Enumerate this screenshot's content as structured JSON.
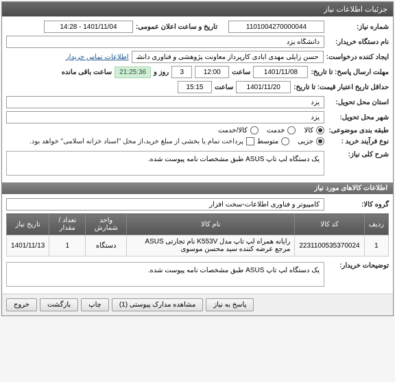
{
  "header": {
    "title": "جزئیات اطلاعات نیاز"
  },
  "fields": {
    "need_number_label": "شماره نیاز:",
    "need_number": "1101004270000044",
    "announce_label": "تاریخ و ساعت اعلان عمومی:",
    "announce_value": "1401/11/04 - 14:28",
    "org_label": "نام دستگاه خریدار:",
    "org_value": "دانشگاه یزد",
    "creator_label": "ایجاد کننده درخواست:",
    "creator_value": "حسن زایلی مهدی آبادی کارپرداز معاونت پژوهشی و فناوری دانشگاه یزد",
    "contact_link": "اطلاعات تماس خریدار",
    "deadline_label": "مهلت ارسال پاسخ: تا تاریخ:",
    "deadline_date": "1401/11/08",
    "time_label": "ساعت",
    "deadline_time": "12:00",
    "days_count": "3",
    "days_label": "روز و",
    "remain_time": "21:25:36",
    "remain_label": "ساعت باقی مانده",
    "valid_label": "حداقل تاریخ اعتبار قیمت: تا تاریخ:",
    "valid_date": "1401/11/20",
    "valid_time": "15:15",
    "exec_loc_label": "استان محل تحویل:",
    "exec_loc": "یزد",
    "city_label": "شهر محل تحویل:",
    "city": "یزد",
    "category_label": "طبقه بندی موضوعی:",
    "cat_kala": "کالا",
    "cat_khedmat": "خدمت",
    "cat_kalakhedmat": "کالا/خدمت",
    "buy_type_label": "نوع فرآیند خرید :",
    "buy_cash": "جزیی",
    "buy_credit": "متوسط",
    "payment_note": "پرداخت تمام یا بخشی از مبلغ خرید،از محل \"اسناد خزانه اسلامی\" خواهد بود.",
    "summary_label": "شرح کلی نیاز:",
    "summary_value": "یک دستگاه لپ تاپ ASUS طبق مشخصات نامه پیوست شده.",
    "group_label": "گروه کالا:",
    "group_value": "کامپیوتر و فناوری اطلاعات-سخت افزار",
    "buyer_desc_label": "توضیحات خریدار:",
    "buyer_desc_value": "یک دستگاه لپ تاپ ASUS طبق مشخصات نامه پیوست شده."
  },
  "section_titles": {
    "items": "اطلاعات کالاهای مورد نیاز"
  },
  "table": {
    "headers": {
      "row": "ردیف",
      "code": "کد کالا",
      "name": "نام کالا",
      "unit": "واحد شمارش",
      "qty": "تعداد / مقدار",
      "date": "تاریخ نیاز"
    },
    "rows": [
      {
        "row": "1",
        "code": "2231100535370024",
        "name": "رایانه همراه لپ تاپ مدل K553V نام تجارتی ASUS مرجع عرضه کننده سید محسن موسوی",
        "unit": "دستگاه",
        "qty": "1",
        "date": "1401/11/13"
      }
    ]
  },
  "buttons": {
    "respond": "پاسخ به نیاز",
    "attachments": "مشاهده مدارک پیوستی (1)",
    "print": "چاپ",
    "back": "بازگشت",
    "exit": "خروج"
  }
}
